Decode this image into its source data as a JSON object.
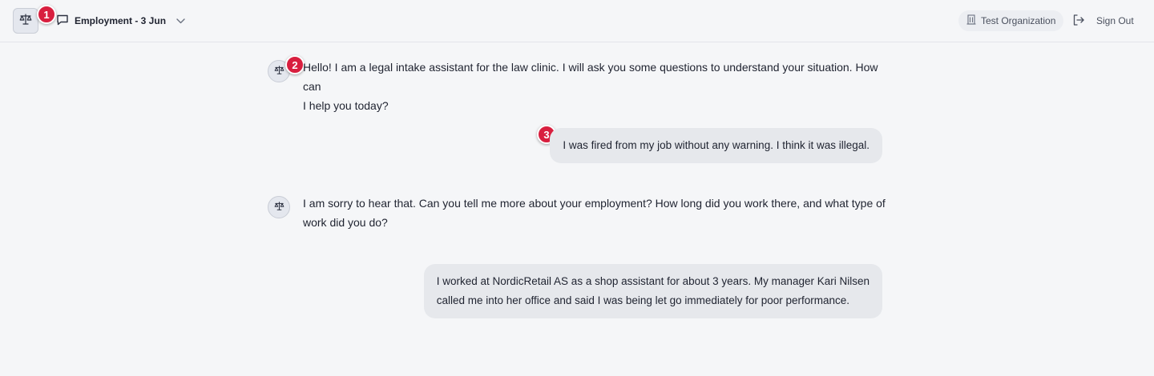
{
  "header": {
    "conversation_title": "Employment - 3 Jun",
    "organization": "Test Organization",
    "sign_out": "Sign Out"
  },
  "messages": [
    {
      "role": "assistant",
      "lines": [
        "Hello! I am a legal intake assistant for the law clinic. I will ask you some questions to understand your situation. How can",
        "I help you today?"
      ]
    },
    {
      "role": "user",
      "lines": [
        "I was fired from my job without any warning. I think it was illegal."
      ]
    },
    {
      "role": "assistant",
      "lines": [
        "I am sorry to hear that. Can you tell me more about your employment? How long did you work there, and what type of",
        "work did you do?"
      ]
    },
    {
      "role": "user",
      "lines": [
        "I worked at NordicRetail AS as a shop assistant for about 3 years. My manager Kari Nilsen",
        "called me into her office and said I was being let go immediately for poor performance."
      ]
    }
  ],
  "markers": [
    "1",
    "2",
    "3"
  ],
  "colors": {
    "marker": "#d81f3f",
    "background": "#f5f6f8",
    "user_bubble": "#e6e8ec"
  },
  "icons": {
    "logo": "scales-icon",
    "conversation": "chat-bubble-icon",
    "dropdown": "chevron-down-icon",
    "organization": "building-icon",
    "sign_out": "logout-icon"
  }
}
